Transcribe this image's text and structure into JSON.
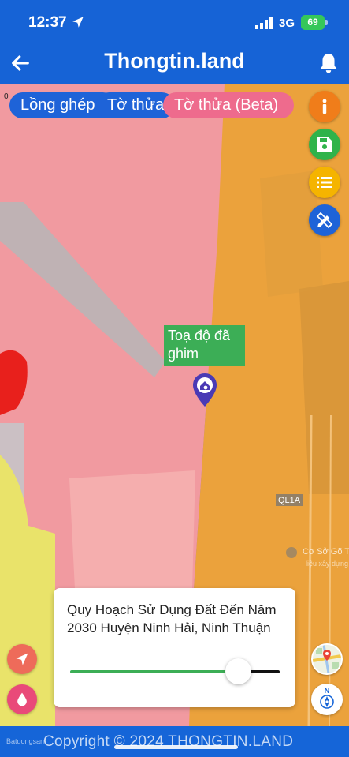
{
  "status_bar": {
    "time": "12:37",
    "network": "3G",
    "battery": "69"
  },
  "header": {
    "title": "Thongtin.land"
  },
  "chips": [
    {
      "label": "Lồng ghép"
    },
    {
      "label": "Tờ thửa"
    },
    {
      "label": "Tờ thửa (Beta)"
    }
  ],
  "map": {
    "corner_mark": "0",
    "pin_label": "Toạ độ đã ghim",
    "road_label": "QL1A",
    "poi_label": "Cơ Sở Gõ T",
    "poi_sub": "liệu xây dựng"
  },
  "card": {
    "title": "Quy Hoạch Sử Dụng Đất Đến Năm 2030 Huyện Ninh Hải, Ninh Thuận",
    "opacity_level": 0.8
  },
  "compass": {
    "north": "N"
  },
  "footer": {
    "copyright": "Copyright © 2024 THONGTIN.LAND",
    "watermark": "Batdongsan"
  },
  "colors": {
    "header_blue": "#1663d6",
    "chip_pink": "#ee6b8d",
    "fab_orange": "#f07d1a",
    "fab_green": "#2fb34a",
    "fab_yellow": "#f5b400",
    "fab_blue": "#1e63d8",
    "pin_tag_green": "#3cae56",
    "pin_purple": "#4a3ab5",
    "zone_pink": "#f19aa0",
    "zone_orange": "#f0a43a",
    "zone_yellow": "#e9e36a"
  },
  "icons": {
    "back": "arrow-left-icon",
    "bell": "bell-icon",
    "info": "info-icon",
    "save": "save-icon",
    "list": "list-icon",
    "edit": "pencil-ruler-icon",
    "locate": "navigation-arrow-icon",
    "drop": "water-drop-icon",
    "layers": "map-layers-icon",
    "compass": "compass-icon"
  }
}
